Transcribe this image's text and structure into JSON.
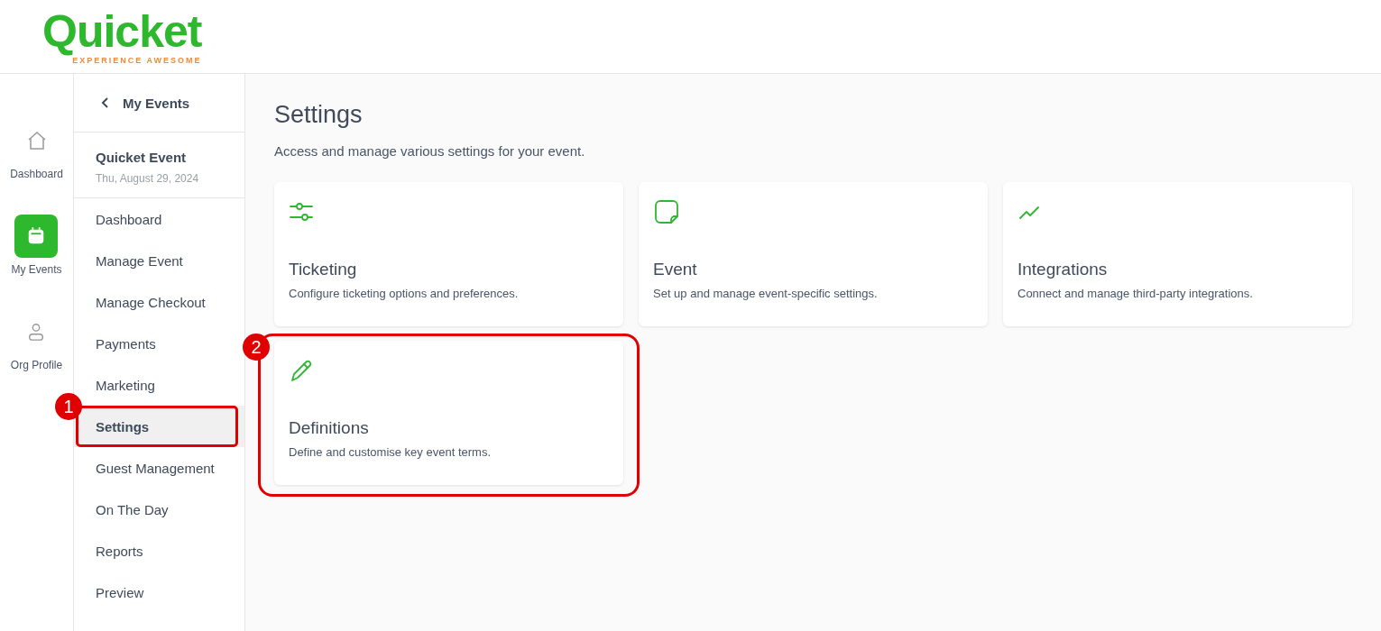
{
  "logo": {
    "name": "Quicket",
    "tagline": "EXPERIENCE AWESOME"
  },
  "rail": [
    {
      "label": "Dashboard",
      "selected": false
    },
    {
      "label": "My Events",
      "selected": true
    },
    {
      "label": "Org Profile",
      "selected": false
    }
  ],
  "subnav": {
    "back": "My Events",
    "event_title": "Quicket Event",
    "event_date": "Thu, August 29, 2024",
    "items": [
      {
        "label": "Dashboard",
        "selected": false
      },
      {
        "label": "Manage Event",
        "selected": false
      },
      {
        "label": "Manage Checkout",
        "selected": false
      },
      {
        "label": "Payments",
        "selected": false
      },
      {
        "label": "Marketing",
        "selected": false
      },
      {
        "label": "Settings",
        "selected": true,
        "callout": "1"
      },
      {
        "label": "Guest Management",
        "selected": false
      },
      {
        "label": "On The Day",
        "selected": false
      },
      {
        "label": "Reports",
        "selected": false
      },
      {
        "label": "Preview",
        "selected": false
      }
    ]
  },
  "page": {
    "title": "Settings",
    "subtitle": "Access and manage various settings for your event."
  },
  "cards": [
    {
      "title": "Ticketing",
      "description": "Configure ticketing options and preferences."
    },
    {
      "title": "Event",
      "description": "Set up and manage event-specific settings."
    },
    {
      "title": "Integrations",
      "description": "Connect and manage third-party integrations."
    },
    {
      "title": "Definitions",
      "description": "Define and customise key event terms.",
      "callout": "2"
    }
  ]
}
